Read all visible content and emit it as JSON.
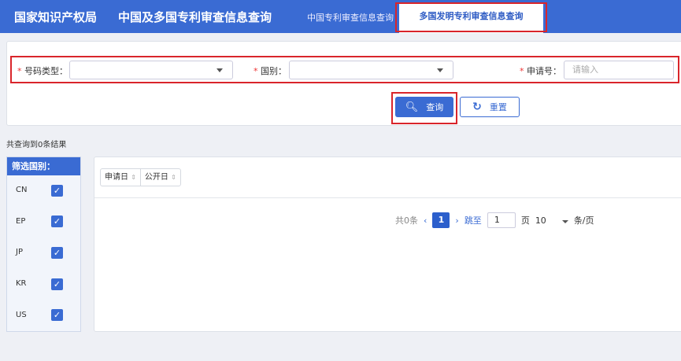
{
  "header": {
    "logo": "国家知识产权局",
    "title": "中国及多国专利审查信息查询",
    "tabs": [
      {
        "label": "中国专利审查信息查询"
      },
      {
        "label": "多国发明专利审查信息查询"
      }
    ]
  },
  "form": {
    "number_type_label": "号码类型：",
    "country_label": "国别：",
    "app_no_label": "申请号：",
    "app_no_placeholder": "请输入",
    "required_mark": "*",
    "search_label": "查询",
    "reset_label": "重置"
  },
  "results": {
    "summary": "共查询到0条结果"
  },
  "filter": {
    "title": "筛选国别：",
    "countries": [
      {
        "code": "CN",
        "checked": true
      },
      {
        "code": "EP",
        "checked": true
      },
      {
        "code": "JP",
        "checked": true
      },
      {
        "code": "KR",
        "checked": true
      },
      {
        "code": "US",
        "checked": true
      }
    ]
  },
  "sort": {
    "app_date": "申请日",
    "pub_date": "公开日"
  },
  "pagination": {
    "total": "共0条",
    "current": "1",
    "goto_label": "跳至",
    "goto_value": "1",
    "page_unit": "页",
    "page_size": "10",
    "per_page_unit": "条/页"
  },
  "colors": {
    "primary": "#3a6bd3",
    "highlight": "#d9252b"
  }
}
